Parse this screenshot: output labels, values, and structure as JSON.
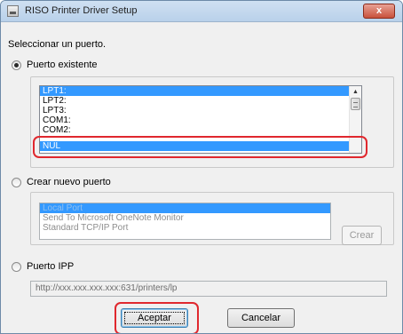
{
  "window": {
    "title": "RISO Printer Driver Setup",
    "close_label": "x"
  },
  "prompt": "Seleccionar un puerto.",
  "existing_port": {
    "label": "Puerto existente",
    "selected": true,
    "items": [
      "LPT1:",
      "LPT2:",
      "LPT3:",
      "COM1:",
      "COM2:"
    ],
    "selected_items": [
      "LPT1:"
    ],
    "highlighted_item": "NUL"
  },
  "new_port": {
    "label": "Crear nuevo puerto",
    "selected": false,
    "items": [
      "Local Port",
      "Send To Microsoft OneNote Monitor",
      "Standard TCP/IP Port"
    ],
    "create_label": "Crear"
  },
  "ipp_port": {
    "label": "Puerto IPP",
    "selected": false,
    "url": "http://xxx.xxx.xxx.xxx:631/printers/lp"
  },
  "footer": {
    "accept_label": "Aceptar",
    "cancel_label": "Cancelar"
  },
  "colors": {
    "selection": "#3399ff",
    "highlight_ring": "#e0282e"
  }
}
